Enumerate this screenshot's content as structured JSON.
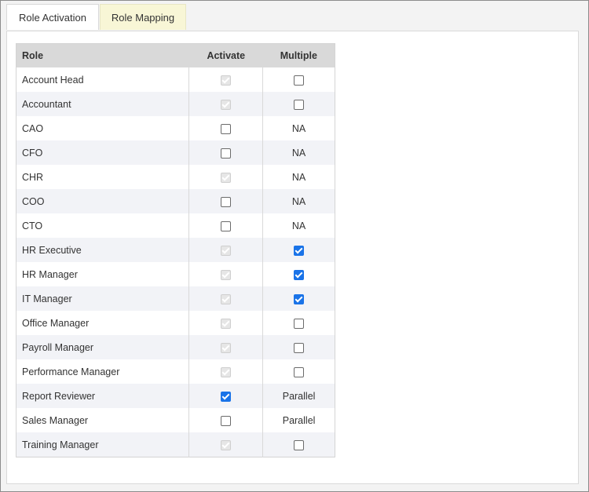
{
  "tabs": [
    {
      "label": "Role Activation",
      "active": false
    },
    {
      "label": "Role Mapping",
      "active": true
    }
  ],
  "table": {
    "headers": {
      "role": "Role",
      "activate": "Activate",
      "multiple": "Multiple"
    },
    "rows": [
      {
        "role": "Account Head",
        "activate": "checked-disabled",
        "multiple": "unchecked"
      },
      {
        "role": "Accountant",
        "activate": "checked-disabled",
        "multiple": "unchecked"
      },
      {
        "role": "CAO",
        "activate": "unchecked",
        "multiple": "NA"
      },
      {
        "role": "CFO",
        "activate": "unchecked",
        "multiple": "NA"
      },
      {
        "role": "CHR",
        "activate": "checked-disabled",
        "multiple": "NA"
      },
      {
        "role": "COO",
        "activate": "unchecked",
        "multiple": "NA"
      },
      {
        "role": "CTO",
        "activate": "unchecked",
        "multiple": "NA"
      },
      {
        "role": "HR Executive",
        "activate": "checked-disabled",
        "multiple": "checked"
      },
      {
        "role": "HR Manager",
        "activate": "checked-disabled",
        "multiple": "checked"
      },
      {
        "role": "IT Manager",
        "activate": "checked-disabled",
        "multiple": "checked"
      },
      {
        "role": "Office Manager",
        "activate": "checked-disabled",
        "multiple": "unchecked"
      },
      {
        "role": "Payroll Manager",
        "activate": "checked-disabled",
        "multiple": "unchecked"
      },
      {
        "role": "Performance Manager",
        "activate": "checked-disabled",
        "multiple": "unchecked"
      },
      {
        "role": "Report Reviewer",
        "activate": "checked",
        "multiple": "Parallel"
      },
      {
        "role": "Sales Manager",
        "activate": "unchecked",
        "multiple": "Parallel"
      },
      {
        "role": "Training Manager",
        "activate": "checked-disabled",
        "multiple": "unchecked"
      }
    ]
  },
  "colors": {
    "accent": "#1a73e8",
    "active_tab": "#f8f6d6",
    "header_bg": "#d9d9d9",
    "alt_row": "#f2f3f7"
  }
}
